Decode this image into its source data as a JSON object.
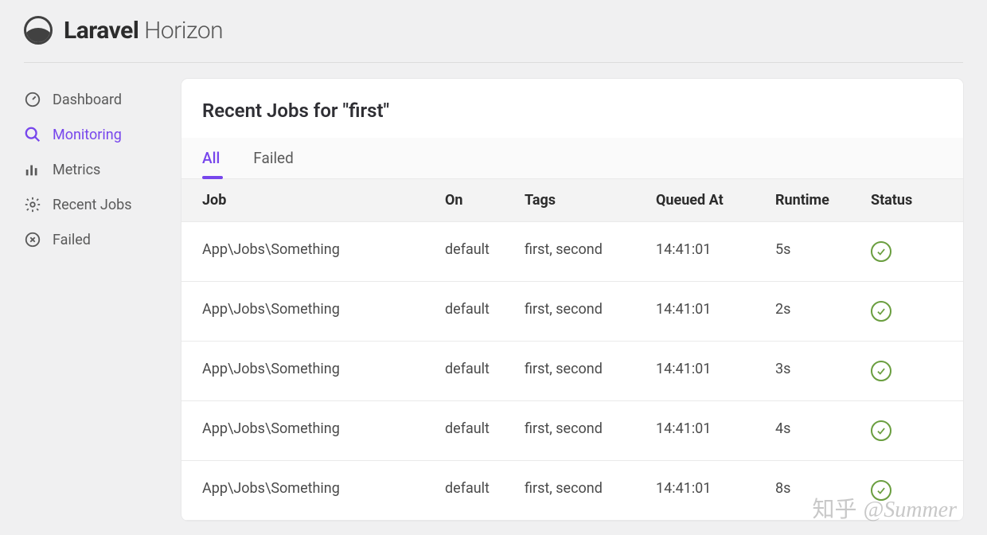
{
  "brand": {
    "bold": "Laravel",
    "light": "Horizon"
  },
  "sidebar": {
    "items": [
      {
        "label": "Dashboard",
        "icon": "gauge-icon",
        "active": false
      },
      {
        "label": "Monitoring",
        "icon": "search-icon",
        "active": true
      },
      {
        "label": "Metrics",
        "icon": "bars-icon",
        "active": false
      },
      {
        "label": "Recent Jobs",
        "icon": "gear-icon",
        "active": false
      },
      {
        "label": "Failed",
        "icon": "close-circle-icon",
        "active": false
      }
    ]
  },
  "main": {
    "title": "Recent Jobs for \"first\"",
    "tabs": [
      {
        "label": "All",
        "active": true
      },
      {
        "label": "Failed",
        "active": false
      }
    ],
    "columns": {
      "job": "Job",
      "on": "On",
      "tags": "Tags",
      "queued": "Queued At",
      "runtime": "Runtime",
      "status": "Status"
    },
    "rows": [
      {
        "job": "App\\Jobs\\Something",
        "on": "default",
        "tags": "first, second",
        "queued": "14:41:01",
        "runtime": "5s",
        "status": "success"
      },
      {
        "job": "App\\Jobs\\Something",
        "on": "default",
        "tags": "first, second",
        "queued": "14:41:01",
        "runtime": "2s",
        "status": "success"
      },
      {
        "job": "App\\Jobs\\Something",
        "on": "default",
        "tags": "first, second",
        "queued": "14:41:01",
        "runtime": "3s",
        "status": "success"
      },
      {
        "job": "App\\Jobs\\Something",
        "on": "default",
        "tags": "first, second",
        "queued": "14:41:01",
        "runtime": "4s",
        "status": "success"
      },
      {
        "job": "App\\Jobs\\Something",
        "on": "default",
        "tags": "first, second",
        "queued": "14:41:01",
        "runtime": "8s",
        "status": "success"
      }
    ]
  },
  "watermark": {
    "zh": "知乎",
    "handle": "@Summer"
  }
}
